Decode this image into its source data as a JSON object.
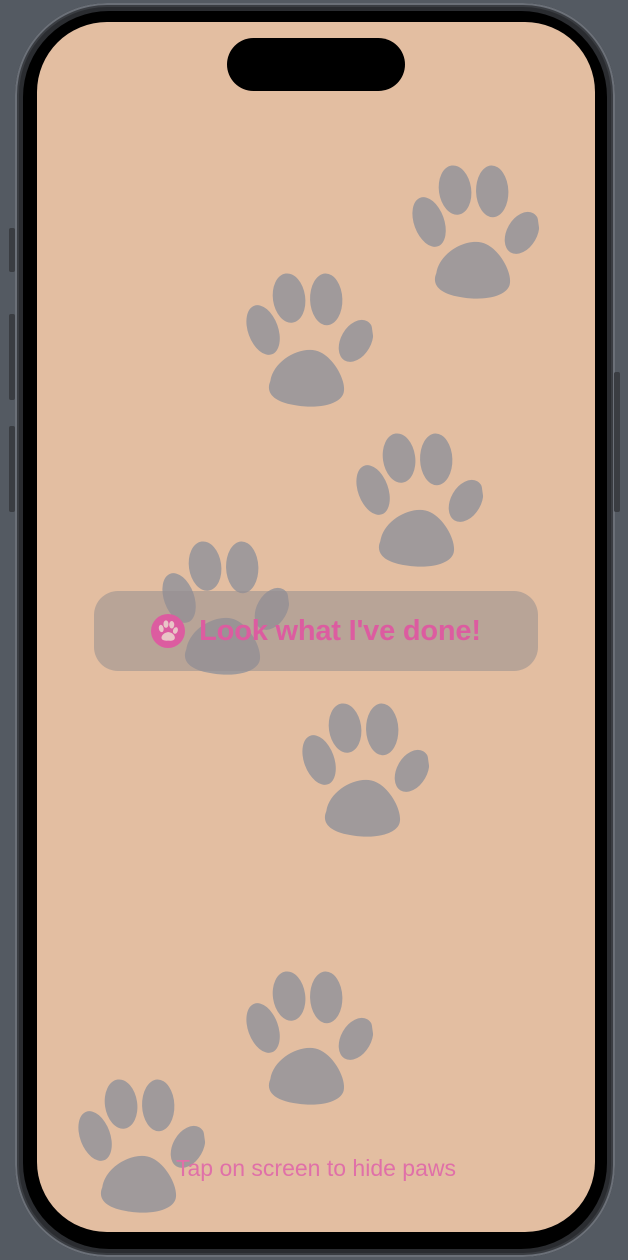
{
  "screen": {
    "background_color": "#e3bea1",
    "paw_color": "#a09a9b",
    "accent_color": "#dc5ca0",
    "paw_icon": "paw-print-icon"
  },
  "banner": {
    "label": "Look what I've done!",
    "icon": "paw-circle-icon"
  },
  "hint": {
    "text": "Tap on screen to hide paws"
  }
}
